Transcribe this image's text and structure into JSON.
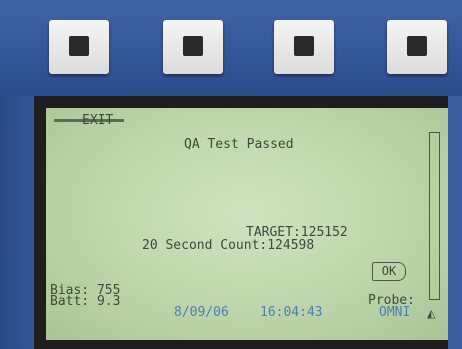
{
  "softkeys": [
    {
      "icon": "square-key-icon"
    },
    {
      "icon": "square-key-icon"
    },
    {
      "icon": "square-key-icon"
    },
    {
      "icon": "square-key-icon"
    }
  ],
  "screen": {
    "exit_label": "EXIT",
    "status_message": "QA Test Passed",
    "target_line": "TARGET:125152",
    "count_line": "20 Second Count:124598",
    "ok_label": "OK",
    "bias_line": "Bias: 755",
    "batt_line": "Batt: 9.3",
    "date": "8/09/06",
    "time": "16:04:43",
    "probe_label": "Probe:",
    "probe_value": "OMNI",
    "speaker_icon": "speaker-icon"
  },
  "colors": {
    "bezel": "#2e4e88",
    "lcd_background": "#bcd6aa",
    "lcd_text": "#3e4a3a",
    "lcd_highlight_text": "#4a7fb5"
  }
}
